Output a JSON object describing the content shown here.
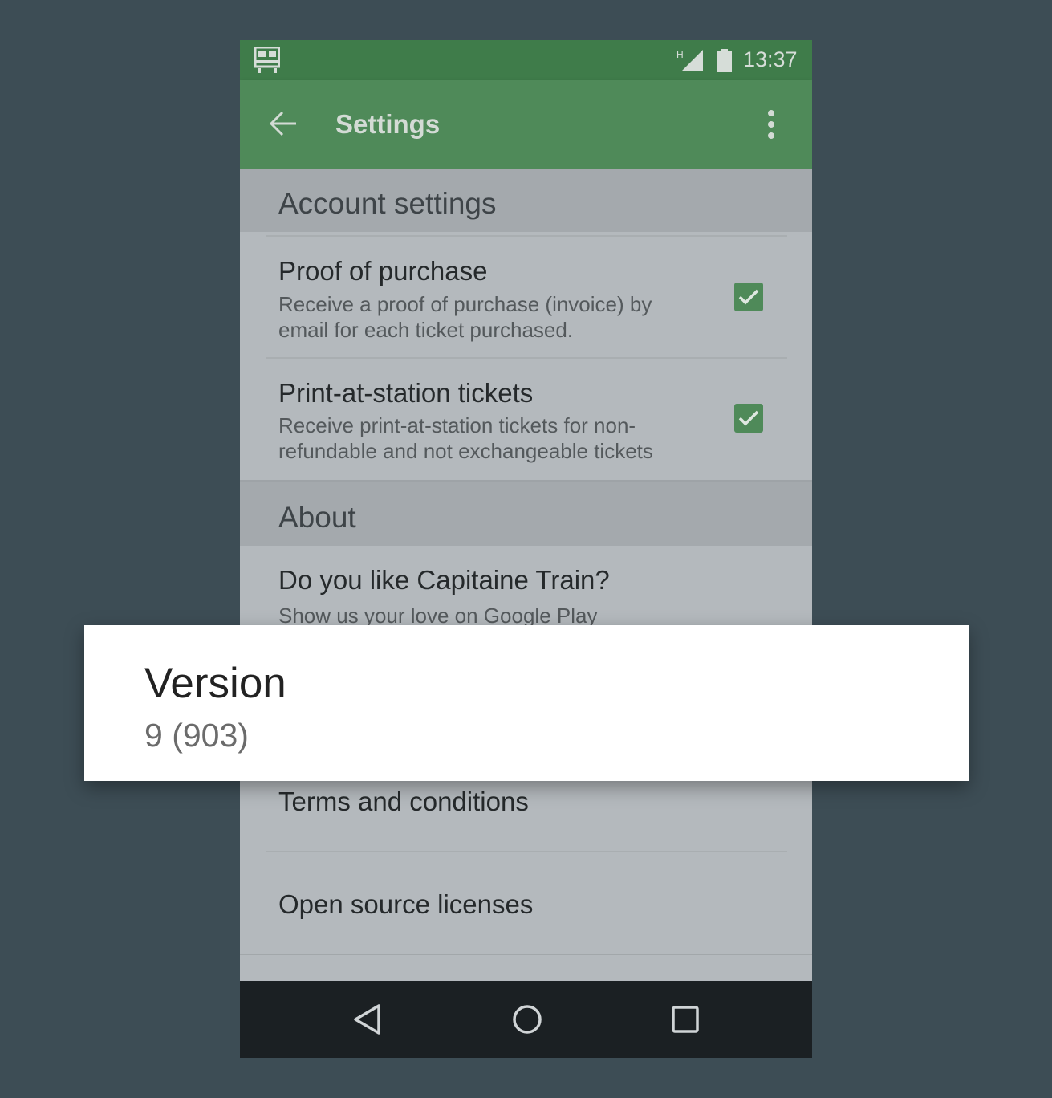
{
  "status_bar": {
    "time": "13:37",
    "network_type": "H",
    "icons": [
      "train-app-icon",
      "signal-icon",
      "battery-icon"
    ]
  },
  "app_bar": {
    "title": "Settings",
    "back_icon": "arrow-back-icon",
    "menu_icon": "more-vert-icon"
  },
  "sections": {
    "account": {
      "header": "Account settings",
      "items": [
        {
          "title": "Proof of purchase",
          "subtitle_line1": "Receive a proof of purchase (invoice) by",
          "subtitle_line2": "email for each ticket purchased.",
          "checked": true
        },
        {
          "title": "Print-at-station tickets",
          "subtitle_line1": "Receive print-at-station tickets for non-",
          "subtitle_line2": "refundable and not exchangeable tickets",
          "checked": true
        }
      ]
    },
    "about": {
      "header": "About",
      "rate": {
        "title": "Do you like Capitaine Train?",
        "subtitle": "Show us your love on Google Play"
      },
      "terms": "Terms and conditions",
      "licenses": "Open source licenses"
    }
  },
  "version_card": {
    "label": "Version",
    "value": "9 (903)"
  },
  "nav_bar": {
    "icons": [
      "back-triangle-icon",
      "home-circle-icon",
      "recents-square-icon"
    ]
  },
  "colors": {
    "background": "#3d4d55",
    "status_bar": "#3f7c4a",
    "app_bar": "#4f8a59",
    "accent_checkbox": "#4f8a59",
    "content_dimmed": "#b4b9bd",
    "nav_bar": "#1b2023"
  }
}
